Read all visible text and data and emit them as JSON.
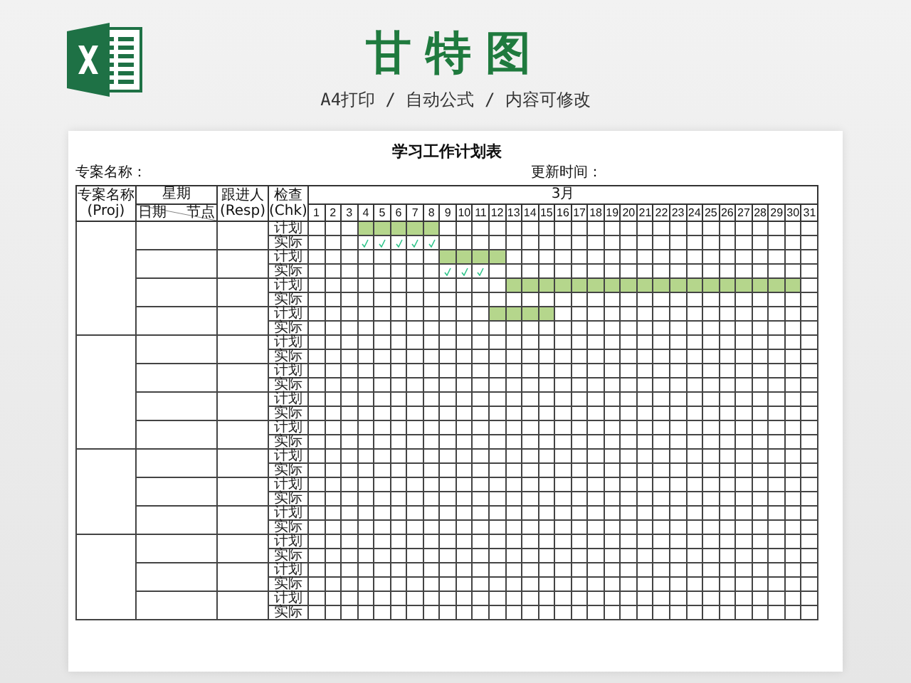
{
  "header": {
    "title": "甘特图",
    "subtitle": "A4打印 / 自动公式 / 内容可修改"
  },
  "sheet": {
    "title": "学习工作计划表",
    "project_label": "专案名称：",
    "updated_label": "更新时间：",
    "columns": {
      "project": [
        "专案名称",
        "(Proj)"
      ],
      "week": "星期",
      "date": "日期",
      "node": "节点",
      "resp": [
        "跟进人",
        "(Resp)"
      ],
      "check": [
        "检查",
        "(Chk)"
      ]
    },
    "month": "3月",
    "days": [
      "1",
      "2",
      "3",
      "4",
      "5",
      "6",
      "7",
      "8",
      "9",
      "10",
      "11",
      "12",
      "13",
      "14",
      "15",
      "16",
      "17",
      "18",
      "19",
      "20",
      "21",
      "22",
      "23",
      "24",
      "25",
      "26",
      "27",
      "28",
      "29",
      "30",
      "31"
    ],
    "projects": [
      {
        "tasks": [
          {
            "plan_label": "计划",
            "actual_label": "实际",
            "plan": [
              false,
              false,
              false,
              true,
              true,
              true,
              true,
              true,
              false,
              false,
              false,
              false,
              false,
              false,
              false,
              false,
              false,
              false,
              false,
              false,
              false,
              false,
              false,
              false,
              false,
              false,
              false,
              false,
              false,
              false,
              false
            ],
            "actual_checked": [
              false,
              false,
              false,
              true,
              true,
              true,
              true,
              true,
              false,
              false,
              false,
              false,
              false,
              false,
              false,
              false,
              false,
              false,
              false,
              false,
              false,
              false,
              false,
              false,
              false,
              false,
              false,
              false,
              false,
              false,
              false
            ]
          },
          {
            "plan_label": "计划",
            "actual_label": "实际",
            "plan": [
              false,
              false,
              false,
              false,
              false,
              false,
              false,
              false,
              true,
              true,
              true,
              true,
              false,
              false,
              false,
              false,
              false,
              false,
              false,
              false,
              false,
              false,
              false,
              false,
              false,
              false,
              false,
              false,
              false,
              false,
              false
            ],
            "actual_checked": [
              false,
              false,
              false,
              false,
              false,
              false,
              false,
              false,
              true,
              true,
              true,
              false,
              false,
              false,
              false,
              false,
              false,
              false,
              false,
              false,
              false,
              false,
              false,
              false,
              false,
              false,
              false,
              false,
              false,
              false,
              false
            ]
          },
          {
            "plan_label": "计划",
            "actual_label": "实际",
            "plan": [
              false,
              false,
              false,
              false,
              false,
              false,
              false,
              false,
              false,
              false,
              false,
              false,
              true,
              true,
              true,
              true,
              true,
              true,
              true,
              true,
              true,
              true,
              true,
              true,
              true,
              true,
              true,
              true,
              true,
              true,
              false
            ]
          },
          {
            "plan_label": "计划",
            "actual_label": "实际",
            "plan": [
              false,
              false,
              false,
              false,
              false,
              false,
              false,
              false,
              false,
              false,
              false,
              true,
              true,
              true,
              true,
              false,
              false,
              false,
              false,
              false,
              false,
              false,
              false,
              false,
              false,
              false,
              false,
              false,
              false,
              false,
              false
            ]
          }
        ]
      },
      {
        "tasks": [
          {
            "plan_label": "计划",
            "actual_label": "实际"
          },
          {
            "plan_label": "计划",
            "actual_label": "实际"
          },
          {
            "plan_label": "计划",
            "actual_label": "实际"
          },
          {
            "plan_label": "计划",
            "actual_label": "实际"
          }
        ]
      },
      {
        "tasks": [
          {
            "plan_label": "计划",
            "actual_label": "实际"
          },
          {
            "plan_label": "计划",
            "actual_label": "实际"
          },
          {
            "plan_label": "计划",
            "actual_label": "实际"
          }
        ]
      },
      {
        "tasks": [
          {
            "plan_label": "计划",
            "actual_label": "实际"
          },
          {
            "plan_label": "计划",
            "actual_label": "实际"
          },
          {
            "plan_label": "计划",
            "actual_label": "实际"
          }
        ]
      }
    ]
  }
}
